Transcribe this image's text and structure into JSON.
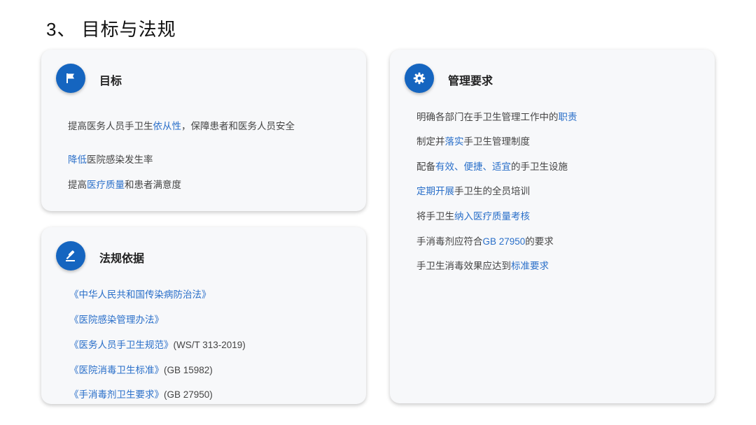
{
  "page": {
    "title": "3、 目标与法规"
  },
  "colors": {
    "accent": "#1565c0",
    "highlight": "#2a6fc9",
    "card_bg": "#f7f8fa"
  },
  "goals": {
    "icon": "flag-icon",
    "title": "目标",
    "items": [
      {
        "parts": [
          {
            "t": "提高医务人员手卫生",
            "h": false
          },
          {
            "t": "依从性",
            "h": true
          },
          {
            "t": "，保障患者和医务人员安全",
            "h": false
          }
        ]
      },
      {
        "parts": [
          {
            "t": "降低",
            "h": true
          },
          {
            "t": "医院感染发生率",
            "h": false
          }
        ]
      },
      {
        "parts": [
          {
            "t": "提高",
            "h": false
          },
          {
            "t": "医疗质量",
            "h": true
          },
          {
            "t": "和患者满意度",
            "h": false
          }
        ]
      }
    ]
  },
  "laws": {
    "icon": "gavel-icon",
    "title": "法规依据",
    "items": [
      {
        "parts": [
          {
            "t": "《中华人民共和国传染病防治法》",
            "h": true
          }
        ]
      },
      {
        "parts": [
          {
            "t": "《医院感染管理办法》",
            "h": true
          }
        ]
      },
      {
        "parts": [
          {
            "t": "《医务人员手卫生规范》",
            "h": true
          },
          {
            "t": "(WS/T 313-2019)",
            "h": false
          }
        ]
      },
      {
        "parts": [
          {
            "t": "《医院消毒卫生标准》",
            "h": true
          },
          {
            "t": "(GB 15982)",
            "h": false
          }
        ]
      },
      {
        "parts": [
          {
            "t": "《手消毒剂卫生要求》",
            "h": true
          },
          {
            "t": "(GB 27950)",
            "h": false
          }
        ]
      }
    ]
  },
  "requirements": {
    "icon": "gear-icon",
    "title": "管理要求",
    "items": [
      {
        "parts": [
          {
            "t": "明确各部门在手卫生管理工作中的",
            "h": false
          },
          {
            "t": "职责",
            "h": true
          }
        ]
      },
      {
        "parts": [
          {
            "t": "制定并",
            "h": false
          },
          {
            "t": "落实",
            "h": true
          },
          {
            "t": "手卫生管理制度",
            "h": false
          }
        ]
      },
      {
        "parts": [
          {
            "t": "配备",
            "h": false
          },
          {
            "t": "有效、便捷、适宜",
            "h": true
          },
          {
            "t": "的手卫生设施",
            "h": false
          }
        ]
      },
      {
        "parts": [
          {
            "t": "定期开展",
            "h": true
          },
          {
            "t": "手卫生的全员培训",
            "h": false
          }
        ]
      },
      {
        "parts": [
          {
            "t": "将手卫生",
            "h": false
          },
          {
            "t": "纳入医疗质量考核",
            "h": true
          }
        ]
      },
      {
        "parts": [
          {
            "t": "手消毒剂应符合",
            "h": false
          },
          {
            "t": "GB 27950",
            "h": true
          },
          {
            "t": "的要求",
            "h": false
          }
        ]
      },
      {
        "parts": [
          {
            "t": "手卫生消毒效果应达到",
            "h": false
          },
          {
            "t": "标准要求",
            "h": true
          }
        ]
      }
    ]
  }
}
